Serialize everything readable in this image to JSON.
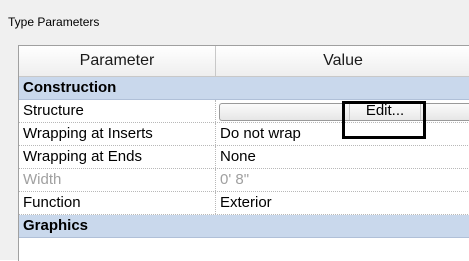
{
  "section": {
    "title": "Type Parameters"
  },
  "table": {
    "headers": {
      "parameter": "Parameter",
      "value": "Value"
    },
    "groups": [
      {
        "name": "Construction"
      },
      {
        "name": "Graphics"
      }
    ],
    "rows": [
      {
        "parameter": "Structure",
        "value": "Edit...",
        "kind": "button"
      },
      {
        "parameter": "Wrapping at Inserts",
        "value": "Do not wrap",
        "kind": "select"
      },
      {
        "parameter": "Wrapping at Ends",
        "value": "None",
        "kind": "select"
      },
      {
        "parameter": "Width",
        "value": "0'  8\"",
        "kind": "readonly"
      },
      {
        "parameter": "Function",
        "value": "Exterior",
        "kind": "select"
      }
    ]
  },
  "colors": {
    "group_background": "#c9d8ec",
    "disabled_text": "#a0a0a0",
    "callout_border": "#000000"
  }
}
